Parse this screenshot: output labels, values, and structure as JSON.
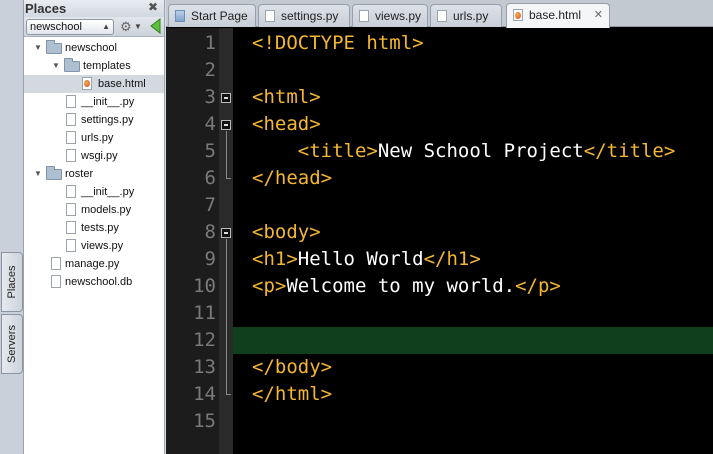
{
  "sidebar": {
    "tabs": [
      "Places",
      "Servers"
    ],
    "places_title": "Places",
    "project": "newschool",
    "tree": [
      {
        "label": "newschool",
        "type": "folder",
        "expanded": true
      },
      {
        "label": "templates",
        "type": "folder",
        "expanded": true
      },
      {
        "label": "base.html",
        "type": "html",
        "selected": true
      },
      {
        "label": "__init__.py",
        "type": "file"
      },
      {
        "label": "settings.py",
        "type": "file"
      },
      {
        "label": "urls.py",
        "type": "file"
      },
      {
        "label": "wsgi.py",
        "type": "file"
      },
      {
        "label": "roster",
        "type": "folder",
        "expanded": true
      },
      {
        "label": "__init__.py",
        "type": "file"
      },
      {
        "label": "models.py",
        "type": "file"
      },
      {
        "label": "tests.py",
        "type": "file"
      },
      {
        "label": "views.py",
        "type": "file"
      },
      {
        "label": "manage.py",
        "type": "file"
      },
      {
        "label": "newschool.db",
        "type": "file"
      }
    ]
  },
  "editor": {
    "tabs": [
      {
        "label": "Start Page",
        "active": false
      },
      {
        "label": "settings.py",
        "active": false
      },
      {
        "label": "views.py",
        "active": false
      },
      {
        "label": "urls.py",
        "active": false
      },
      {
        "label": "base.html",
        "active": true
      }
    ],
    "current_line": 12,
    "lines": [
      {
        "n": "1",
        "tokens": [
          [
            "tag",
            "<!DOCTYPE html>"
          ]
        ]
      },
      {
        "n": "2",
        "tokens": []
      },
      {
        "n": "3",
        "tokens": [
          [
            "tag",
            "<html>"
          ]
        ]
      },
      {
        "n": "4",
        "tokens": [
          [
            "tag",
            "<head>"
          ]
        ]
      },
      {
        "n": "5",
        "tokens": [
          [
            "txt",
            "    "
          ],
          [
            "tag",
            "<title>"
          ],
          [
            "txt",
            "New School Project"
          ],
          [
            "tag",
            "</title>"
          ]
        ]
      },
      {
        "n": "6",
        "tokens": [
          [
            "tag",
            "</head>"
          ]
        ]
      },
      {
        "n": "7",
        "tokens": []
      },
      {
        "n": "8",
        "tokens": [
          [
            "tag",
            "<body>"
          ]
        ]
      },
      {
        "n": "9",
        "tokens": [
          [
            "tag",
            "<h1>"
          ],
          [
            "txt",
            "Hello World"
          ],
          [
            "tag",
            "</h1>"
          ]
        ]
      },
      {
        "n": "10",
        "tokens": [
          [
            "tag",
            "<p>"
          ],
          [
            "txt",
            "Welcome to my world."
          ],
          [
            "tag",
            "</p>"
          ]
        ]
      },
      {
        "n": "11",
        "tokens": []
      },
      {
        "n": "12",
        "tokens": []
      },
      {
        "n": "13",
        "tokens": [
          [
            "tag",
            "</body>"
          ]
        ]
      },
      {
        "n": "14",
        "tokens": [
          [
            "tag",
            "</html>"
          ]
        ]
      },
      {
        "n": "15",
        "tokens": []
      }
    ]
  }
}
